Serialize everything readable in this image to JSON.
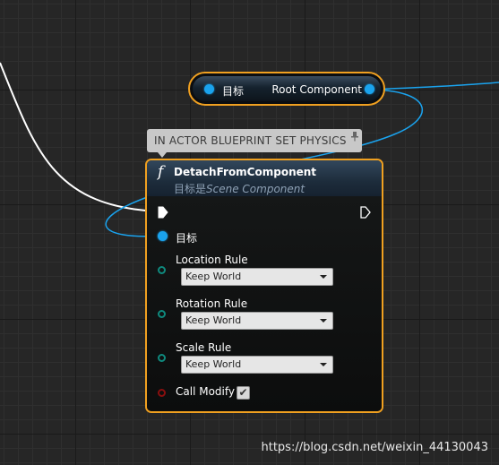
{
  "var_node": {
    "target_label": "目标",
    "output_label": "Root Component"
  },
  "comment": {
    "text": "IN ACTOR BLUEPRINT SET PHYSICS",
    "pin_icon": "pin-icon"
  },
  "func_node": {
    "title": "DetachFromComponent",
    "subtitle_prefix": "目标是",
    "subtitle_type": "Scene Component",
    "target_label": "目标",
    "location_rule": {
      "label": "Location Rule",
      "value": "Keep World"
    },
    "rotation_rule": {
      "label": "Rotation Rule",
      "value": "Keep World"
    },
    "scale_rule": {
      "label": "Scale Rule",
      "value": "Keep World"
    },
    "call_modify": {
      "label": "Call Modify",
      "checked": true,
      "check_glyph": "✔"
    }
  },
  "watermark": "https://blog.csdn.net/weixin_44130043",
  "colors": {
    "node_border": "#f0a020",
    "object_pin": "#1aa3ee",
    "enum_pin": "#0f8a7e",
    "bool_pin": "#8a0f0f",
    "wire_exec": "#ffffff"
  }
}
